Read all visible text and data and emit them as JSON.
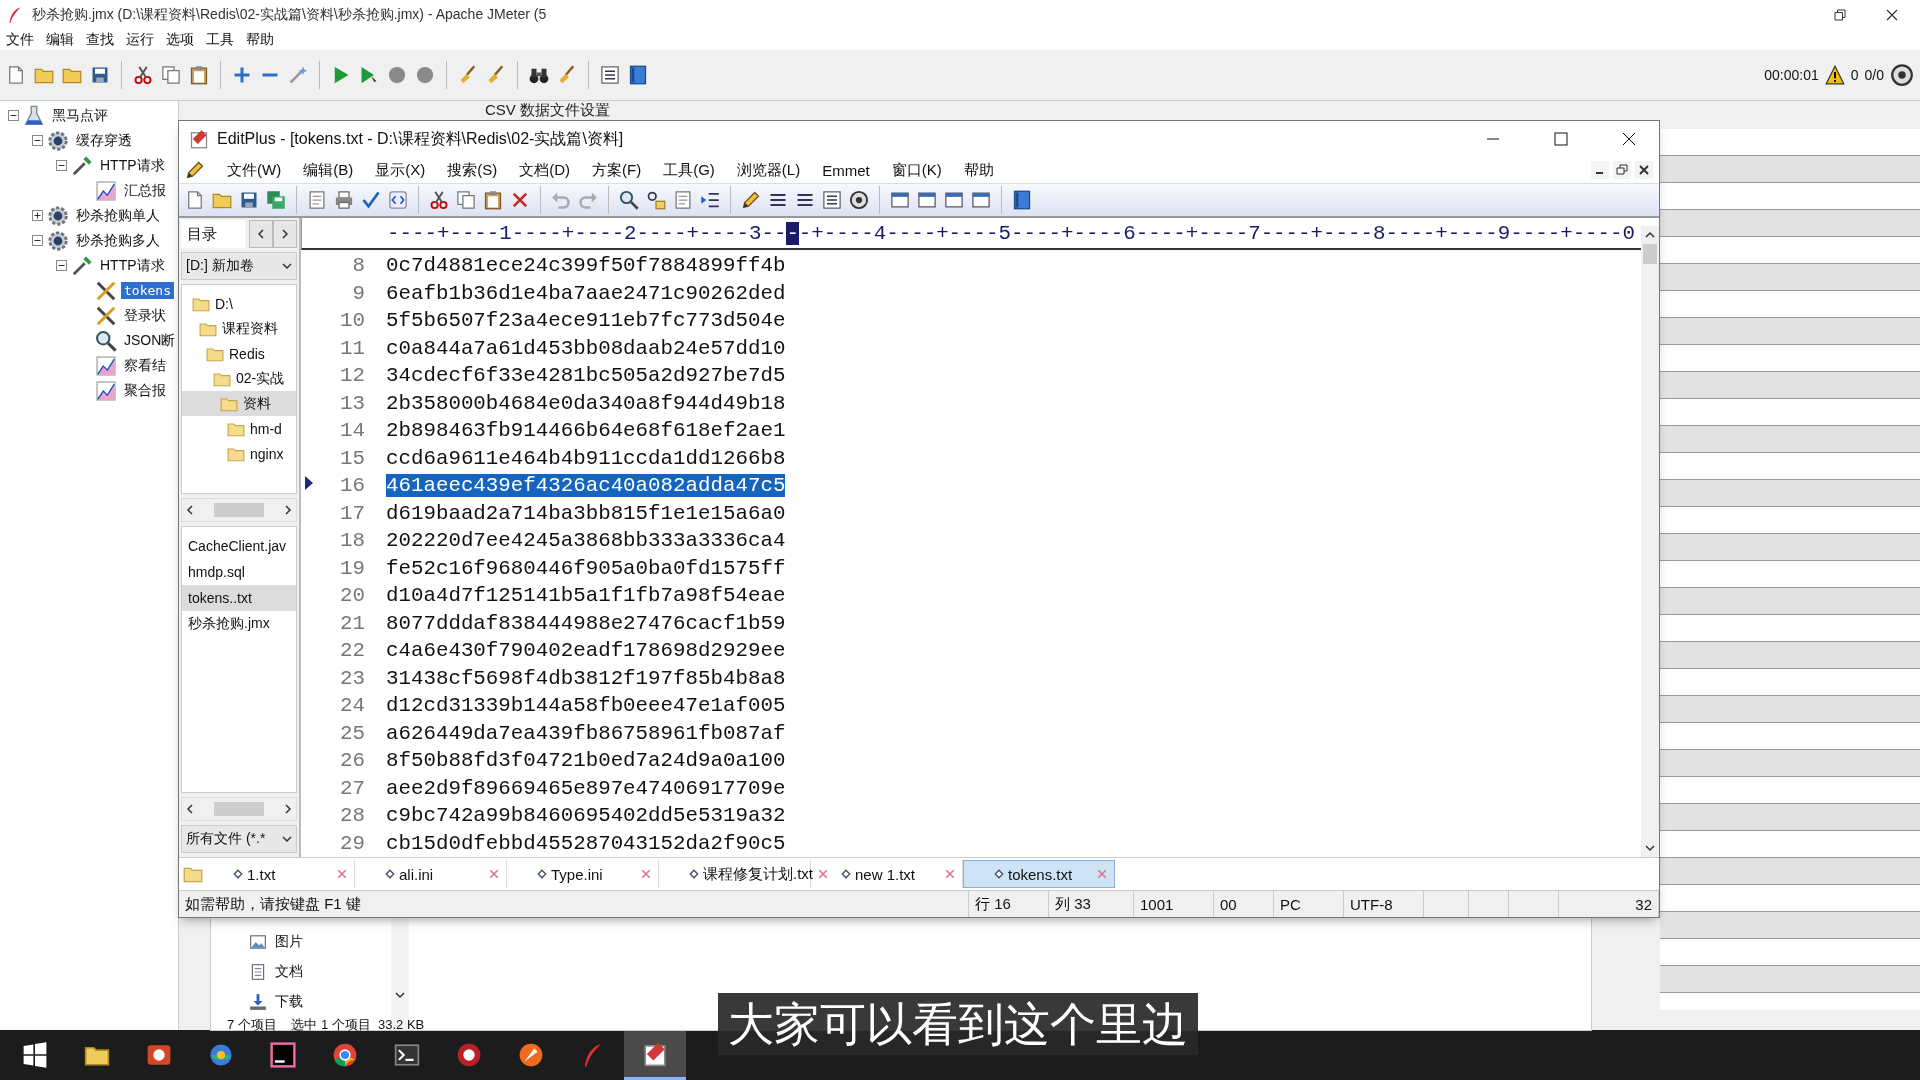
{
  "jmeter": {
    "title": "秒杀抢购.jmx (D:\\课程资料\\Redis\\02-实战篇\\资料\\秒杀抢购.jmx) - Apache JMeter (5",
    "menu": [
      "文件",
      "编辑",
      "查找",
      "运行",
      "选项",
      "工具",
      "帮助"
    ],
    "timer": "00:00:01",
    "warning_count": "0",
    "threads": "0/0",
    "panel_title": "CSV 数据文件设置",
    "tree": [
      {
        "label": "黑马点评",
        "kind": "flask",
        "expanded": true,
        "selected": false,
        "children": [
          {
            "label": "缓存穿透",
            "kind": "gear",
            "expanded": true,
            "selected": false,
            "children": [
              {
                "label": "HTTP请求",
                "kind": "dropper",
                "expanded": true,
                "selected": false,
                "children": [
                  {
                    "label": "汇总报",
                    "kind": "chart",
                    "selected": false
                  }
                ]
              }
            ]
          },
          {
            "label": "秒杀抢购单人",
            "kind": "gear",
            "expanded": false,
            "selected": false
          },
          {
            "label": "秒杀抢购多人",
            "kind": "gear",
            "expanded": true,
            "selected": false,
            "children": [
              {
                "label": "HTTP请求",
                "kind": "dropper",
                "expanded": true,
                "selected": false,
                "children": [
                  {
                    "label": "tokens",
                    "kind": "tools",
                    "selected": true
                  },
                  {
                    "label": "登录状",
                    "kind": "tools",
                    "selected": false
                  },
                  {
                    "label": "JSON断",
                    "kind": "magnifier",
                    "selected": false
                  },
                  {
                    "label": "察看结",
                    "kind": "chart",
                    "selected": false
                  },
                  {
                    "label": "聚合报",
                    "kind": "chart",
                    "selected": false
                  }
                ]
              }
            ]
          }
        ]
      }
    ]
  },
  "editplus": {
    "title": "EditPlus - [tokens.txt - D:\\课程资料\\Redis\\02-实战篇\\资料]",
    "menu": [
      "文件(W)",
      "编辑(B)",
      "显示(X)",
      "搜索(S)",
      "文档(D)",
      "方案(F)",
      "工具(G)",
      "浏览器(L)",
      "Emmet",
      "窗口(K)",
      "帮助"
    ],
    "sidebar_tab": "目录",
    "drive": "[D:] 新加卷",
    "folders": [
      {
        "label": "D:\\",
        "selected": false,
        "children": [
          {
            "label": "课程资料",
            "selected": false,
            "children": [
              {
                "label": "Redis",
                "selected": false,
                "children": [
                  {
                    "label": "02-实战",
                    "selected": false,
                    "children": [
                      {
                        "label": "资料",
                        "selected": true,
                        "children": [
                          {
                            "label": "hm-d",
                            "selected": false
                          },
                          {
                            "label": "nginx",
                            "selected": false
                          }
                        ]
                      }
                    ]
                  }
                ]
              }
            ]
          }
        ]
      }
    ],
    "files": [
      {
        "label": "CacheClient.jav",
        "selected": false
      },
      {
        "label": "hmdp.sql",
        "selected": false
      },
      {
        "label": "tokens..txt",
        "selected": true
      },
      {
        "label": "秒杀抢购.jmx",
        "selected": false
      }
    ],
    "filter": "所有文件 (*.*",
    "ruler": {
      "before": "----+----1----+----2----+----3--",
      "cursor": "-",
      "after": "-+----4----+----5----+----6----+----7----+----8----+----9----+----0"
    },
    "lines": [
      {
        "number": "8",
        "text": "0c7d4881ece24c399f50f7884899ff4b",
        "selected": false
      },
      {
        "number": "9",
        "text": "6eafb1b36d1e4ba7aae2471c90262ded",
        "selected": false
      },
      {
        "number": "10",
        "text": "5f5b6507f23a4ece911eb7fc773d504e",
        "selected": false
      },
      {
        "number": "11",
        "text": "c0a844a7a61d453bb08daab24e57dd10",
        "selected": false
      },
      {
        "number": "12",
        "text": "34cdecf6f33e4281bc505a2d927be7d5",
        "selected": false
      },
      {
        "number": "13",
        "text": "2b358000b4684e0da340a8f944d49b18",
        "selected": false
      },
      {
        "number": "14",
        "text": "2b898463fb914466b64e68f618ef2ae1",
        "selected": false
      },
      {
        "number": "15",
        "text": "ccd6a9611e464b4b911ccda1dd1266b8",
        "selected": false
      },
      {
        "number": "16",
        "text": "461aeec439ef4326ac40a082adda47c5",
        "selected": true
      },
      {
        "number": "17",
        "text": "d619baad2a714ba3bb815f1e1e15a6a0",
        "selected": false
      },
      {
        "number": "18",
        "text": "202220d7ee4245a3868bb333a3336ca4",
        "selected": false
      },
      {
        "number": "19",
        "text": "fe52c16f9680446f905a0ba0fd1575ff",
        "selected": false
      },
      {
        "number": "20",
        "text": "d10a4d7f125141b5a1f1fb7a98f54eae",
        "selected": false
      },
      {
        "number": "21",
        "text": "8077dddaf838444988e27476cacf1b59",
        "selected": false
      },
      {
        "number": "22",
        "text": "c4a6e430f790402eadf178698d2929ee",
        "selected": false
      },
      {
        "number": "23",
        "text": "31438cf5698f4db3812f197f85b4b8a8",
        "selected": false
      },
      {
        "number": "24",
        "text": "d12cd31339b144a58fb0eee47e1af005",
        "selected": false
      },
      {
        "number": "25",
        "text": "a626449da7ea439fb86758961fb087af",
        "selected": false
      },
      {
        "number": "26",
        "text": "8f50b88fd3f04721b0ed7a24d9a0a100",
        "selected": false
      },
      {
        "number": "27",
        "text": "aee2d9f89669465e897e47406917709e",
        "selected": false
      },
      {
        "number": "28",
        "text": "c9bc742a99b8460695402dd5e5319a32",
        "selected": false
      },
      {
        "number": "29",
        "text": "cb15d0dfebbd455287043152da2f90c5",
        "selected": false
      }
    ],
    "tabs": [
      {
        "label": "1.txt",
        "selected": false
      },
      {
        "label": "ali.ini",
        "selected": false
      },
      {
        "label": "Type.ini",
        "selected": false
      },
      {
        "label": "课程修复计划.txt",
        "selected": false
      },
      {
        "label": "new 1.txt",
        "selected": false
      },
      {
        "label": "tokens.txt",
        "selected": true
      }
    ],
    "status": {
      "help": "如需帮助，请按键盘 F1 键",
      "row": "行 16",
      "column": "列 33",
      "size": "1001",
      "code": "00",
      "line_ending": "PC",
      "encoding": "UTF-8",
      "count": "32"
    }
  },
  "explorer": {
    "items": [
      {
        "label": "图片",
        "kind": "pictures"
      },
      {
        "label": "文档",
        "kind": "documents"
      },
      {
        "label": "下载",
        "kind": "downloads"
      }
    ],
    "status": "7 个项目    选中 1 个项目  33.2 KB"
  },
  "taskbar": [
    {
      "kind": "windows",
      "selected": false
    },
    {
      "kind": "folder",
      "selected": false
    },
    {
      "kind": "slides",
      "selected": false
    },
    {
      "kind": "browser",
      "selected": false
    },
    {
      "kind": "ide",
      "selected": false
    },
    {
      "kind": "chrome",
      "selected": false
    },
    {
      "kind": "terminal",
      "selected": false
    },
    {
      "kind": "redis",
      "selected": false
    },
    {
      "kind": "compass",
      "selected": false
    },
    {
      "kind": "feather",
      "selected": false
    },
    {
      "kind": "editor",
      "selected": true
    }
  ],
  "subtitle": "大家可以看到这个里边"
}
